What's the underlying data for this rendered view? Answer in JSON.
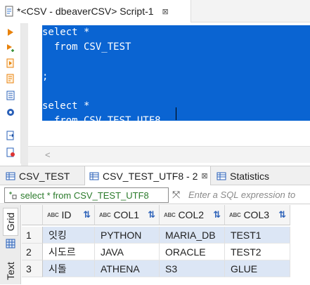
{
  "editor_tab": {
    "title": "*<CSV - dbeaverCSV> Script-1",
    "close_glyph": "⊠"
  },
  "gutter_icons": [
    "execute-statement-icon",
    "execute-in-new-tab-icon",
    "execute-script-icon",
    "explain-plan-icon",
    "load-script-icon",
    "settings-icon",
    "export-icon",
    "save-icon"
  ],
  "code_lines": [
    "select *",
    "  from CSV_TEST",
    "",
    ";",
    "",
    "select *",
    "  from CSV_TEST_UTF8"
  ],
  "result_tabs": [
    {
      "label": "CSV_TEST"
    },
    {
      "label": "CSV_TEST_UTF8 - 2",
      "close_glyph": "⊠"
    },
    {
      "label": "Statistics"
    }
  ],
  "filter": {
    "query": "select * from CSV_TEST_UTF8",
    "placeholder": "Enter a SQL expression to"
  },
  "side_tabs": {
    "grid": "Grid",
    "text": "Text"
  },
  "grid": {
    "type_badge": "ABC",
    "columns": [
      "ID",
      "COL1",
      "COL2",
      "COL3"
    ],
    "rows": [
      {
        "num": "1",
        "cells": [
          "잇킹",
          "PYTHON",
          "MARIA_DB",
          "TEST1"
        ]
      },
      {
        "num": "2",
        "cells": [
          "시도르",
          "JAVA",
          "ORACLE",
          "TEST2"
        ]
      },
      {
        "num": "3",
        "cells": [
          "시돌",
          "ATHENA",
          "S3",
          "GLUE"
        ]
      }
    ]
  },
  "colors": {
    "selection": "#0a64d2",
    "accent_orange": "#e8820c",
    "blue_icon": "#2a60b8",
    "row_highlight": "#dce6f5"
  }
}
